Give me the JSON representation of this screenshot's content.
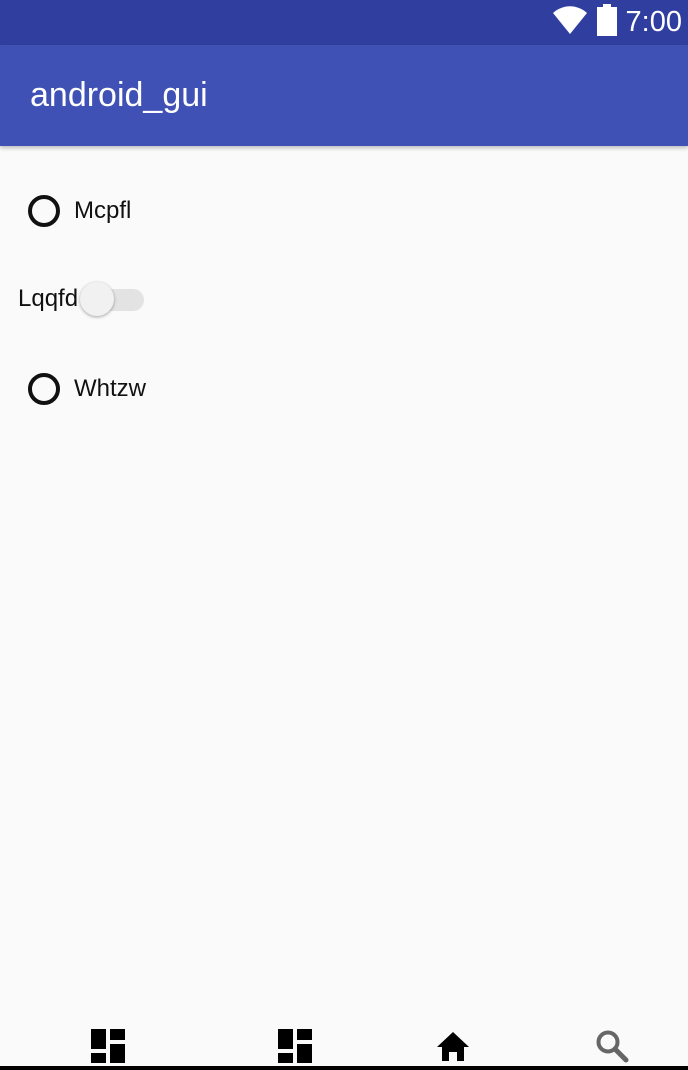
{
  "status_bar": {
    "time": "7:00",
    "icons": [
      "wifi-icon",
      "battery-icon"
    ],
    "color": "#303f9f"
  },
  "app_bar": {
    "title": "android_gui",
    "color": "#3f51b5"
  },
  "content": {
    "radio_1": {
      "label": "Mcpfl",
      "checked": false
    },
    "switch_1": {
      "label": "Lqqfd",
      "on": false
    },
    "radio_2": {
      "label": "Whtzw",
      "checked": false
    }
  },
  "bottom_nav": {
    "items": [
      {
        "icon": "dashboard-icon"
      },
      {
        "icon": "dashboard-icon"
      },
      {
        "icon": "home-icon"
      },
      {
        "icon": "search-icon"
      }
    ]
  }
}
